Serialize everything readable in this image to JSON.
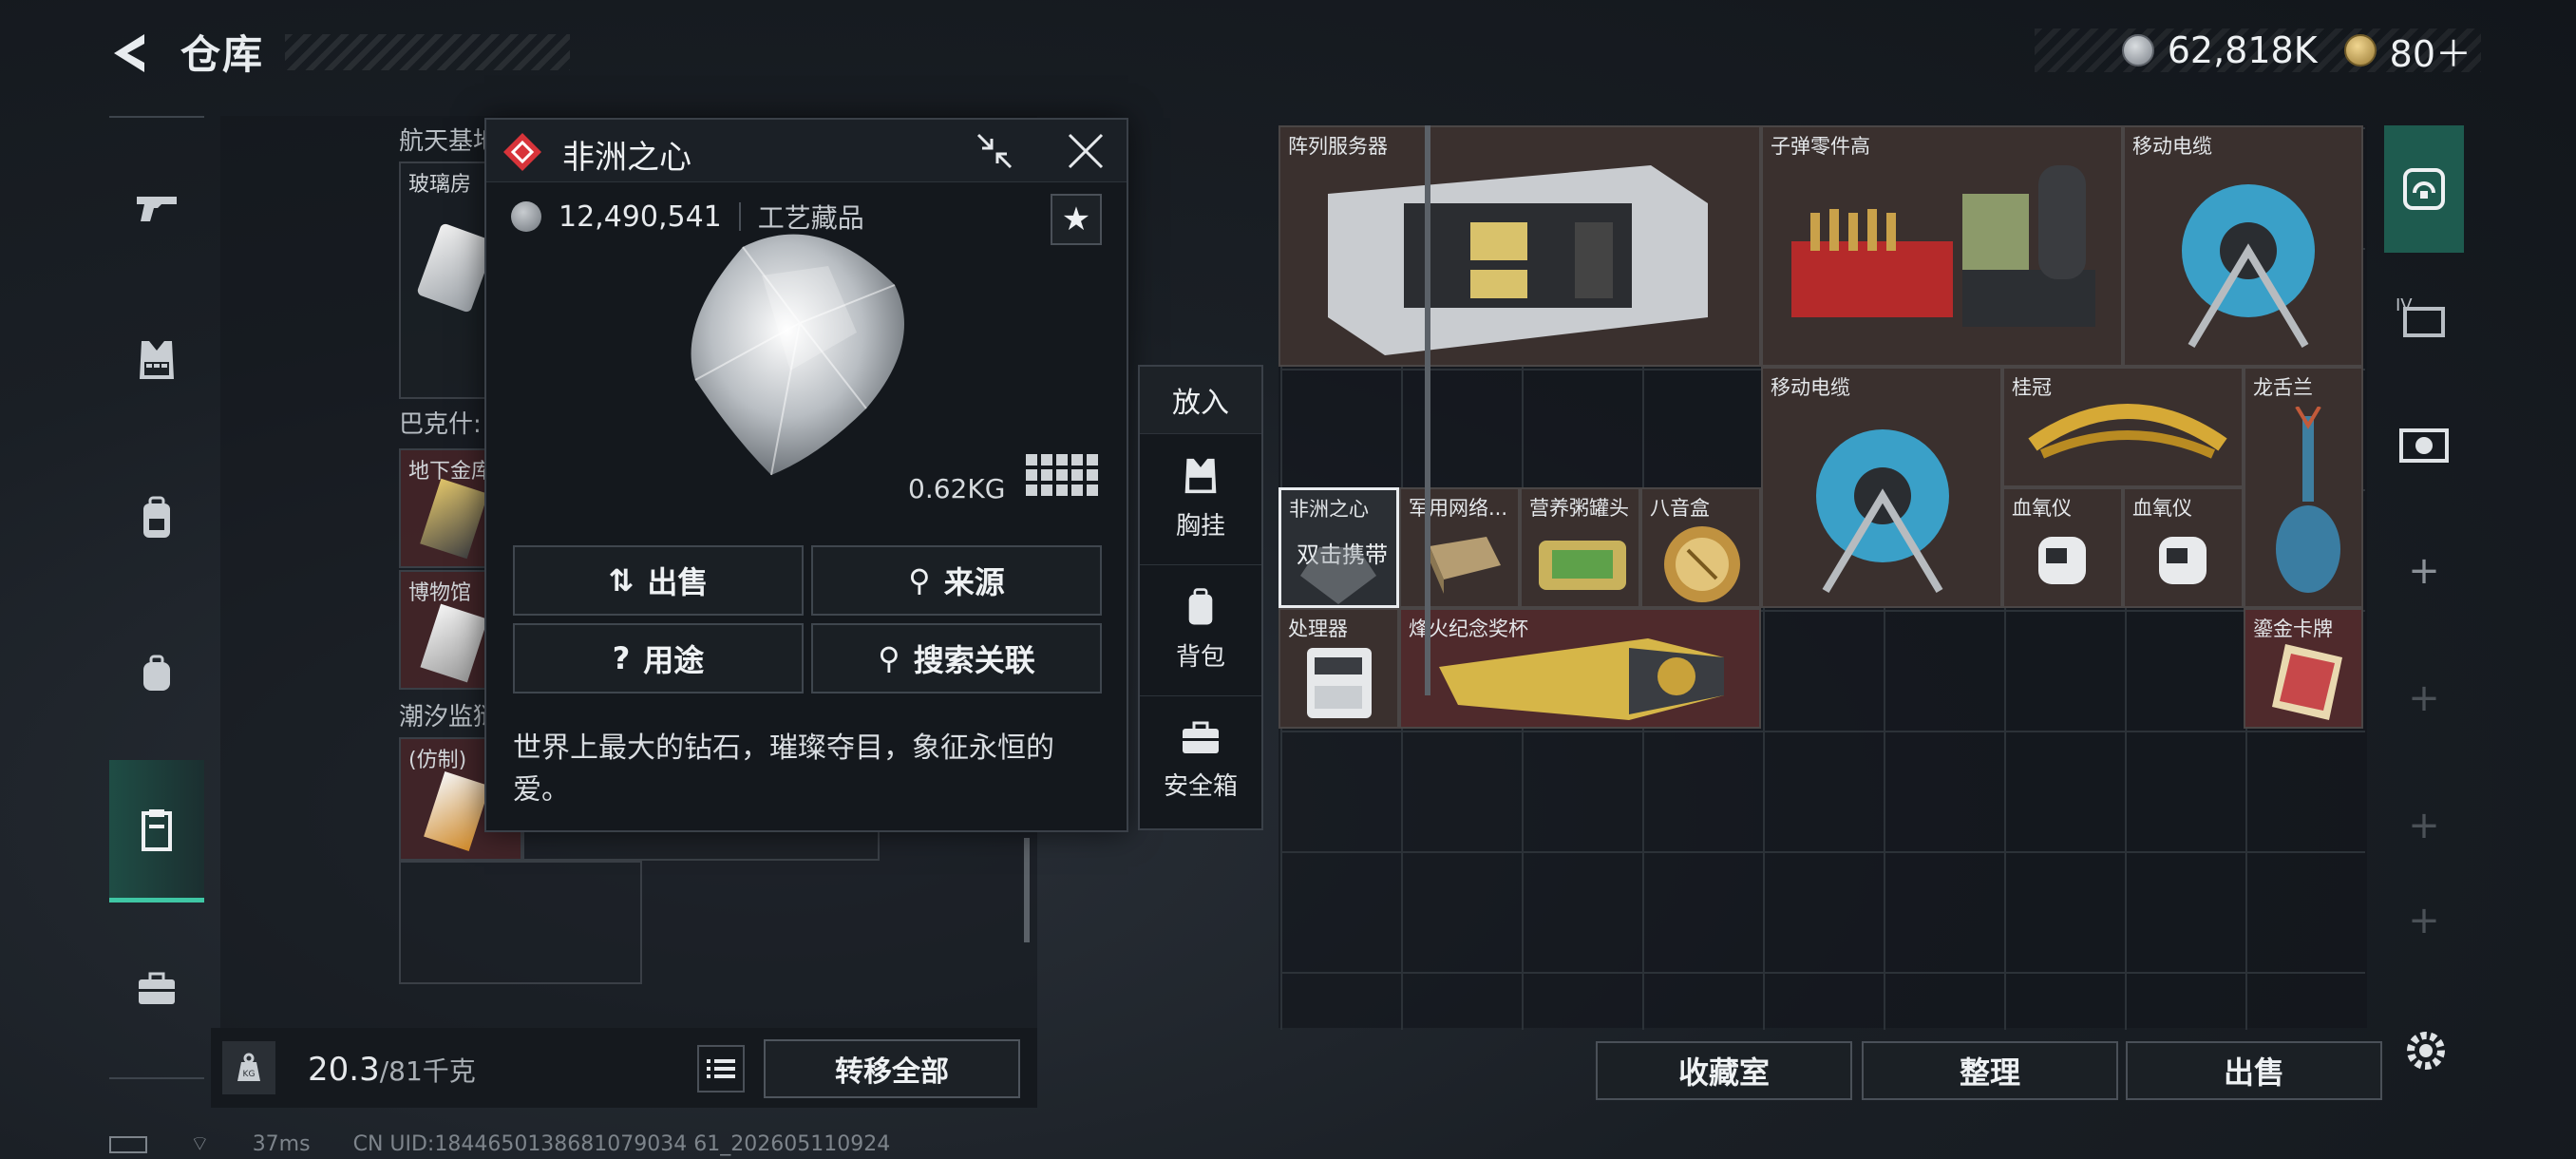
{
  "header": {
    "title": "仓库",
    "currency": [
      {
        "icon": "silver-coin-icon",
        "value": "62,818K"
      },
      {
        "icon": "gold-coin-icon",
        "value": "80＋"
      }
    ]
  },
  "left_rail": {
    "items": [
      {
        "icon": "gun-icon"
      },
      {
        "icon": "vest-icon"
      },
      {
        "icon": "backpack-icon"
      },
      {
        "icon": "small-backpack-icon"
      },
      {
        "icon": "inventory-icon",
        "active": true
      },
      {
        "icon": "briefcase-icon"
      }
    ]
  },
  "left_panel": {
    "sections": [
      {
        "label": "航天基地",
        "items": [
          {
            "label": "玻璃房"
          }
        ]
      },
      {
        "label": "巴克什:",
        "items": [
          {
            "label": "地下金库"
          },
          {
            "label": "博物馆"
          }
        ]
      },
      {
        "label": "潮汐监狱",
        "items": [
          {
            "label": "(仿制)"
          }
        ]
      }
    ],
    "weight": {
      "current": "20.3",
      "max": "/81千克"
    },
    "transfer_all": "转移全部"
  },
  "popup": {
    "title": "非洲之心",
    "price": "12,490,541",
    "category": "工艺藏品",
    "star": "★",
    "weight": "0.62KG",
    "buttons": {
      "sell": "出售",
      "source": "来源",
      "usage": "用途",
      "search_related": "搜索关联"
    },
    "description": "世界上最大的钻石，璀璨夺目，象征永恒的爱。"
  },
  "put_in": {
    "title": "放入",
    "options": [
      {
        "label": "胸挂",
        "icon": "vest-icon"
      },
      {
        "label": "背包",
        "icon": "backpack-icon"
      },
      {
        "label": "安全箱",
        "icon": "safe-box-icon"
      }
    ]
  },
  "right_panel": {
    "items": {
      "server": "阵列服务器",
      "ammo_parts": "子弹零件高",
      "cable1": "移动电缆",
      "cable2": "移动电缆",
      "crown": "桂冠",
      "lily": "龙舌兰",
      "heart": "非洲之心",
      "heart_hint": "双击携带",
      "network": "军用网络...",
      "can": "营养粥罐头",
      "music_box": "八音盒",
      "oximeter1": "血氧仪",
      "oximeter2": "血氧仪",
      "processor": "处理器",
      "trophy": "烽火纪念奖杯",
      "gold_card": "鎏金卡牌"
    },
    "buttons": {
      "collection": "收藏室",
      "organize": "整理",
      "sell": "出售"
    }
  },
  "status": {
    "ping": "37ms",
    "uid": "CN UID:1844650138681079034 61_202605110924"
  }
}
